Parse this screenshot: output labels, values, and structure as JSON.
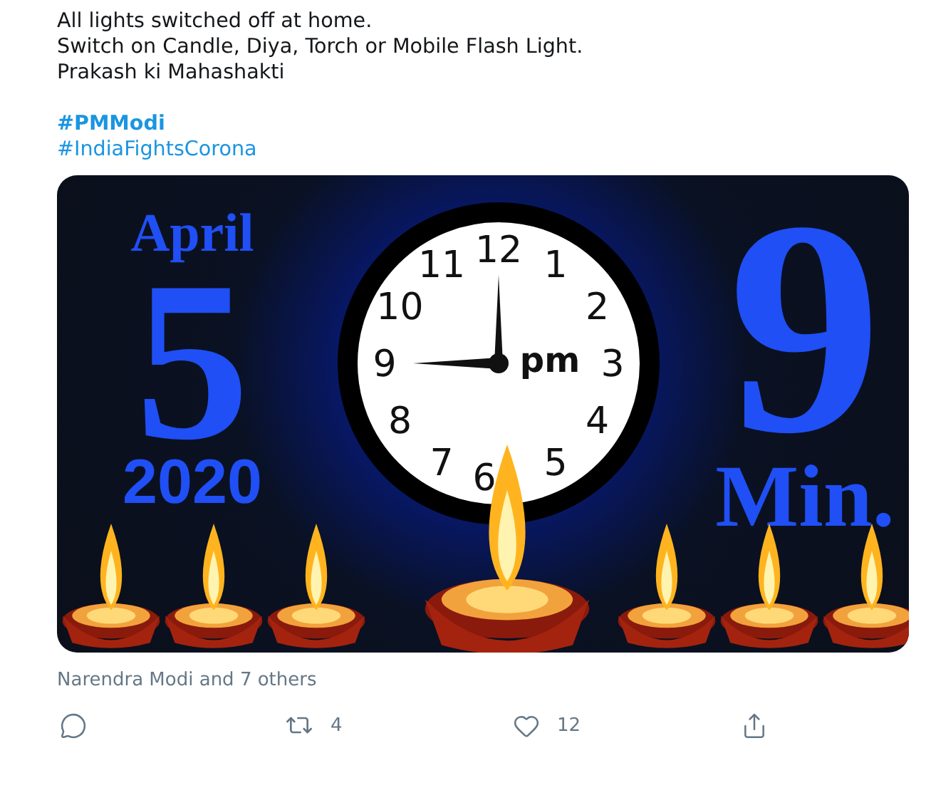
{
  "tweet": {
    "lines": [
      "All lights switched off at home.",
      "Switch on Candle, Diya, Torch or Mobile Flash Light.",
      "Prakash ki Mahashakti"
    ],
    "hashtags": [
      {
        "text": "#PMModi",
        "bold": true
      },
      {
        "text": "#IndiaFightsCorona",
        "bold": false
      }
    ]
  },
  "image": {
    "month": "April",
    "day": "5",
    "year": "2020",
    "clock": {
      "numbers": [
        "12",
        "11",
        "1",
        "10",
        "2",
        "9",
        "3",
        "8",
        "4",
        "7",
        "5",
        "6"
      ],
      "period": "pm"
    },
    "minutes_number": "9",
    "minutes_label": "Min."
  },
  "liked_by": "Narendra Modi and 7 others",
  "actions": [
    {
      "kind": "reply"
    },
    {
      "kind": "retweet",
      "count": "4"
    },
    {
      "kind": "like",
      "count": "12"
    },
    {
      "kind": "share"
    }
  ]
}
